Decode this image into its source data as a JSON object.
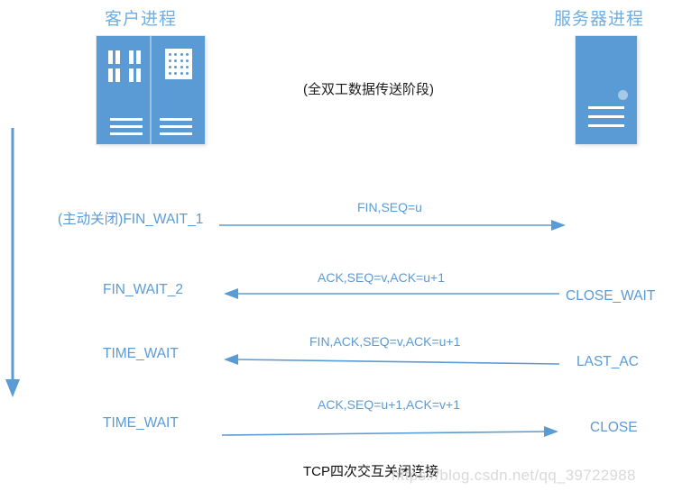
{
  "diagram": {
    "figure_caption": "TCP四次交互关闭连接",
    "watermark": "https://blog.csdn.net/qq_39722988",
    "phase_label": "(全双工数据传送阶段)",
    "accent_color": "#5B9BD5",
    "title_color": "#6FAEE4",
    "background_color": "#ffffff"
  },
  "endpoints": {
    "client": {
      "title": "客户进程",
      "icon": "client-workstation-icon"
    },
    "server": {
      "title": "服务器进程",
      "icon": "server-rack-icon"
    }
  },
  "timeline": {
    "icon": "downward-time-arrow-icon"
  },
  "exchanges": [
    {
      "client_state": "(主动关闭)FIN_WAIT_1",
      "message": "FIN,SEQ=u",
      "direction": "client-to-server",
      "server_state": ""
    },
    {
      "client_state": "FIN_WAIT_2",
      "message": "ACK,SEQ=v,ACK=u+1",
      "direction": "server-to-client",
      "server_state": "CLOSE_WAIT"
    },
    {
      "client_state": "TIME_WAIT",
      "message": "FIN,ACK,SEQ=v,ACK=u+1",
      "direction": "server-to-client",
      "server_state": "LAST_AC"
    },
    {
      "client_state": "TIME_WAIT",
      "message": "ACK,SEQ=u+1,ACK=v+1",
      "direction": "client-to-server",
      "server_state": "CLOSE"
    }
  ]
}
